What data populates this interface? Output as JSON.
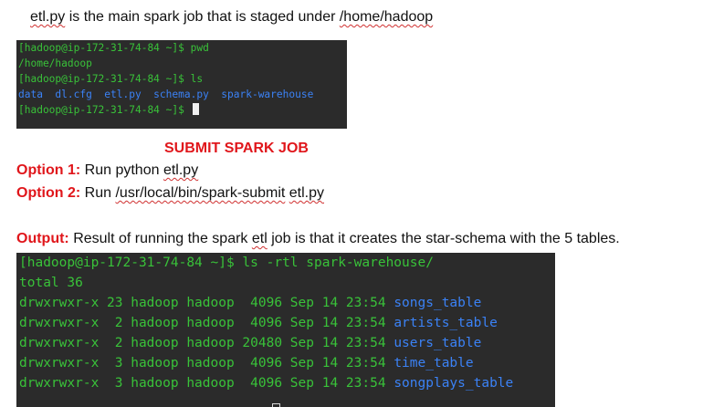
{
  "intro": {
    "file": "etl.py",
    "rest": " is the main spark job that is staged under ",
    "path": "/home/hadoop"
  },
  "terminal_1": {
    "lines": [
      "[hadoop@ip-172-31-74-84 ~]$ pwd",
      "/home/hadoop",
      "[hadoop@ip-172-31-74-84 ~]$ ls"
    ],
    "ls_output_plain": "data  dl.cfg  etl.py  schema.py  ",
    "ls_output_dir": "spark-warehouse",
    "prompt": "[hadoop@ip-172-31-74-84 ~]$ "
  },
  "submit": {
    "heading": "SUBMIT SPARK JOB",
    "option1_label": "Option 1:",
    "option1_pre": " Run python ",
    "option1_file": "etl.py",
    "option2_label": "Option 2:",
    "option2_pre": " Run ",
    "option2_cmd": "/usr/local/bin/spark-submit",
    "option2_space": " ",
    "option2_file": "etl.py"
  },
  "output": {
    "label": "Output:",
    "pre": " Result of running the spark ",
    "etl": "etl",
    "post": " job is that it creates the star-schema with the 5 tables."
  },
  "terminal_2": {
    "command": "[hadoop@ip-172-31-74-84 ~]$ ls -rtl spark-warehouse/",
    "total": "total 36",
    "rows": [
      {
        "meta": "drwxrwxr-x 23 hadoop hadoop  4096 Sep 14 23:54 ",
        "name": "songs_table"
      },
      {
        "meta": "drwxrwxr-x  2 hadoop hadoop  4096 Sep 14 23:54 ",
        "name": "artists_table"
      },
      {
        "meta": "drwxrwxr-x  2 hadoop hadoop 20480 Sep 14 23:54 ",
        "name": "users_table"
      },
      {
        "meta": "drwxrwxr-x  3 hadoop hadoop  4096 Sep 14 23:54 ",
        "name": "time_table"
      },
      {
        "meta": "drwxrwxr-x  3 hadoop hadoop  4096 Sep 14 23:54 ",
        "name": "songplays_table"
      }
    ]
  },
  "colors": {
    "terminal_bg": "#2b2b2b",
    "terminal_text": "#39c239",
    "directory": "#3b82f6",
    "heading_red": "#e0161b"
  }
}
